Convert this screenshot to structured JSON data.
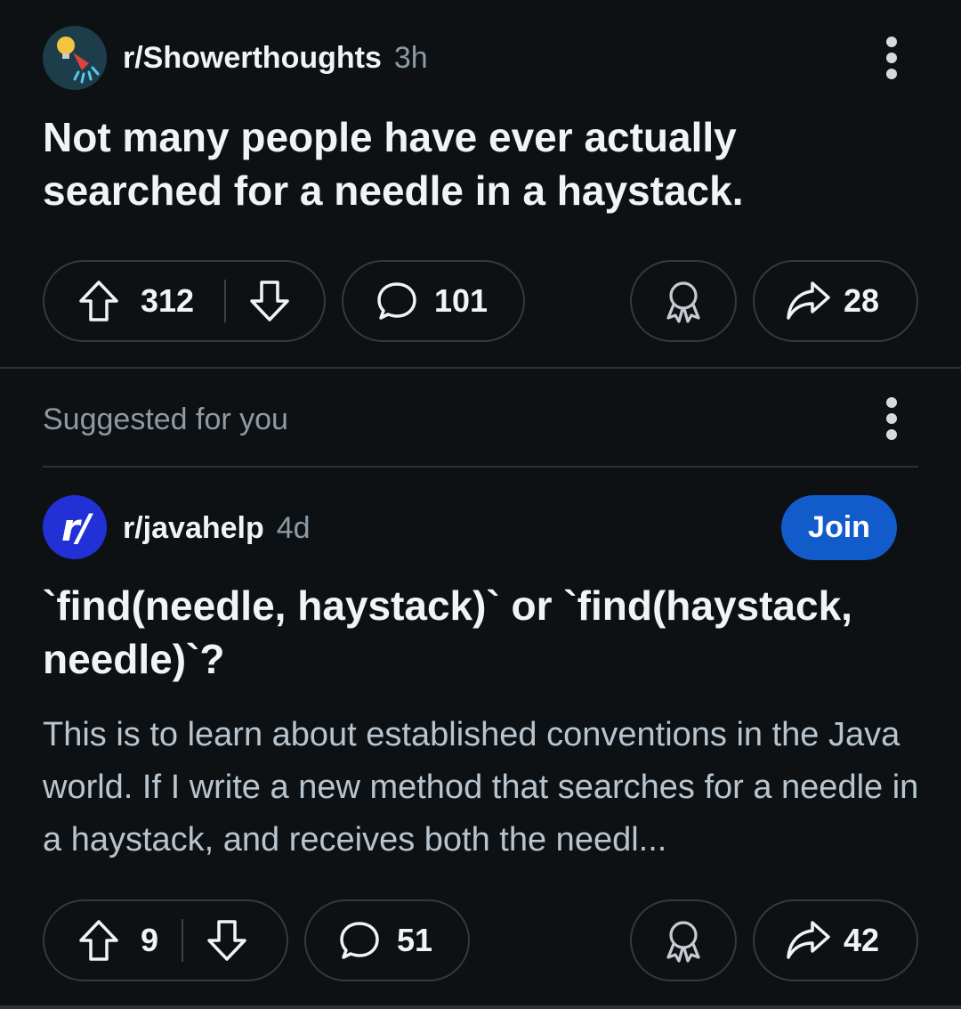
{
  "post": {
    "subreddit": "r/Showerthoughts",
    "age": "3h",
    "title": "Not many people have ever actually searched for a needle in a haystack.",
    "upvotes": "312",
    "comments": "101",
    "shares": "28",
    "avatar_icon": "shower-lightbulb-icon"
  },
  "suggested": {
    "header": "Suggested for you",
    "subreddit": "r/javahelp",
    "age": "4d",
    "join_label": "Join",
    "avatar_text": "r/",
    "title": "`find(needle, haystack)` or `find(haystack, needle)`?",
    "body": "This is to learn about established conventions in the Java world. If I write a new method that searches for a needle in a haystack, and receives both the needl...",
    "upvotes": "9",
    "comments": "51",
    "shares": "42"
  },
  "colors": {
    "background": "#0e1113",
    "join_button": "#115bca",
    "javahelp_avatar": "#2231d6"
  }
}
